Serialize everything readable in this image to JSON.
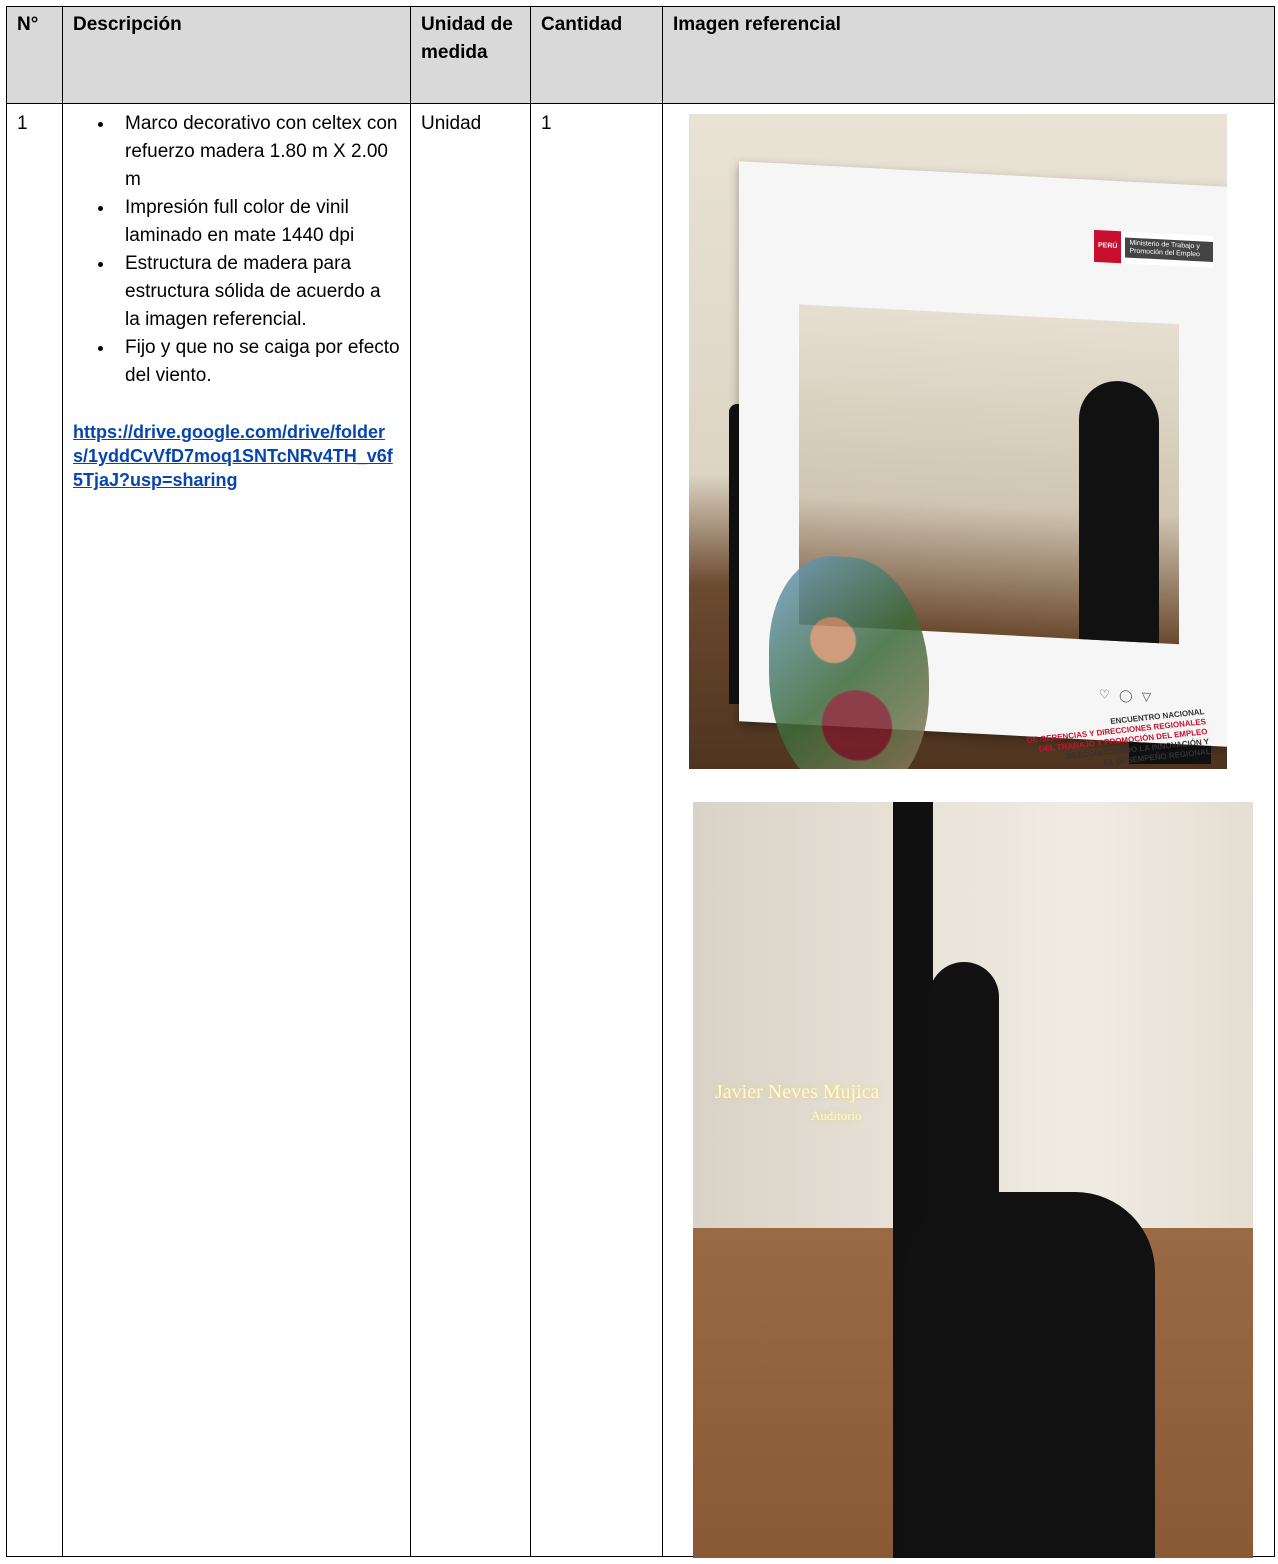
{
  "table": {
    "headers": {
      "number": "N°",
      "description": "Descripción",
      "unit": "Unidad de medida",
      "quantity": "Cantidad",
      "image": "Imagen referencial"
    },
    "row": {
      "number": "1",
      "description_items": [
        "Marco decorativo con celtex con refuerzo madera 1.80 m X 2.00 m",
        "Impresión full color de vinil laminado en mate 1440 dpi",
        "Estructura de madera para estructura sólida de acuerdo a la imagen referencial.",
        "Fijo y que no se caiga por efecto del viento."
      ],
      "link": "https://drive.google.com/drive/folders/1yddCvVfD7moq1SNTcNRv4TH_v6f5TjaJ?usp=sharing",
      "unit": "Unidad",
      "quantity": "1"
    }
  },
  "photo1": {
    "logo_peru": "PERÚ",
    "logo_ministry": "Ministerio de Trabajo y Promoción del Empleo",
    "frame_lines": [
      "ENCUENTRO NACIONAL",
      "DE GERENCIAS Y DIRECCIONES REGIONALES",
      "DEL TRABAJO Y PROMOCIÓN DEL EMPLEO",
      "REECONOCIENDO LA INNOVACIÓN Y",
      "EL DESEMPEÑO REGIONAL"
    ],
    "social_icons": "♡ ◯ ▽"
  },
  "photo2": {
    "sign_line1": "Javier Neves Mujica",
    "sign_line2": "Auditorio"
  }
}
